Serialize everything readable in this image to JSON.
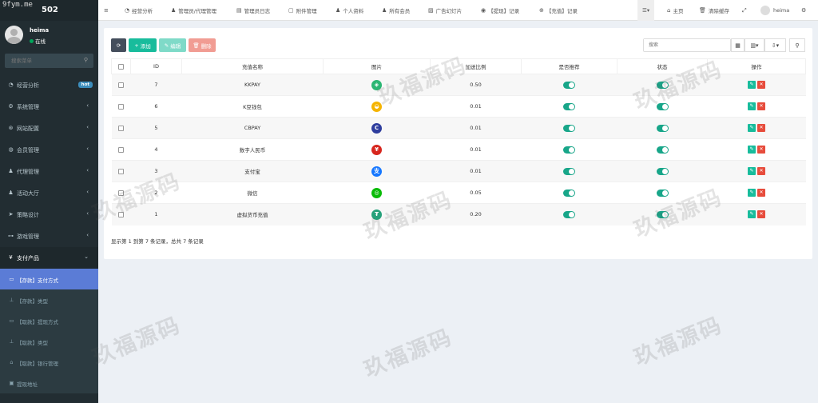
{
  "watermark_url": "9fym.me",
  "brand": "502",
  "user": {
    "name": "heima",
    "status": "在线"
  },
  "sidebar": {
    "search_placeholder": "搜索菜单",
    "items": [
      {
        "icon": "dashboard-icon",
        "label": "经营分析",
        "badge": "hot"
      },
      {
        "icon": "cogs-icon",
        "label": "系统管理"
      },
      {
        "icon": "gear-icon",
        "label": "网站配置"
      },
      {
        "icon": "user-icon",
        "label": "会员管理"
      },
      {
        "icon": "user-icon",
        "label": "代理管理"
      },
      {
        "icon": "user-icon",
        "label": "活动大厅"
      },
      {
        "icon": "paper-plane-icon",
        "label": "策略设计"
      },
      {
        "icon": "gamepad-icon",
        "label": "游戏管理"
      },
      {
        "icon": "yen-icon",
        "label": "支付产品"
      }
    ],
    "sub_items": [
      {
        "icon": "card-icon",
        "label": "【存款】支付方式"
      },
      {
        "icon": "sitemap-icon",
        "label": "【存款】类型"
      },
      {
        "icon": "card-icon",
        "label": "【取款】提现方式"
      },
      {
        "icon": "sitemap-icon",
        "label": "【取款】类型"
      },
      {
        "icon": "bank-icon",
        "label": "【取款】银行管理"
      },
      {
        "icon": "address-icon",
        "label": "提现地址"
      }
    ]
  },
  "topnav": {
    "items": [
      "经营分析",
      "管理员/代理管理",
      "管理员日志",
      "附件管理",
      "个人资料",
      "所有会员",
      "广告幻灯片",
      "【提现】记录",
      "【充值】记录"
    ],
    "home": "主页",
    "clear_cache": "清除缓存",
    "username": "heima"
  },
  "toolbar": {
    "add": "添加",
    "edit": "编辑",
    "delete": "删除",
    "search_placeholder": "搜索"
  },
  "table": {
    "headers": [
      "ID",
      "充值名称",
      "图片",
      "加送比例",
      "是否推荐",
      "状态",
      "操作"
    ],
    "rows": [
      {
        "id": "7",
        "name": "KKPAY",
        "ratio": "0.50",
        "icon": "kkpay-logo-icon",
        "color": "#2bb673"
      },
      {
        "id": "6",
        "name": "K豆钱包",
        "ratio": "0.01",
        "icon": "kdou-wallet-logo-icon",
        "color": "#f5b400"
      },
      {
        "id": "5",
        "name": "CBPAY",
        "ratio": "0.01",
        "icon": "cbpay-logo-icon",
        "color": "#2f3e9e"
      },
      {
        "id": "4",
        "name": "数字人民币",
        "ratio": "0.01",
        "icon": "ecny-logo-icon",
        "color": "#d7261e"
      },
      {
        "id": "3",
        "name": "支付宝",
        "ratio": "0.01",
        "icon": "alipay-logo-icon",
        "color": "#1677ff"
      },
      {
        "id": "2",
        "name": "微信",
        "ratio": "0.05",
        "icon": "wechat-logo-icon",
        "color": "#09bb07"
      },
      {
        "id": "1",
        "name": "虚拟货币充值",
        "ratio": "0.20",
        "icon": "usdt-logo-icon",
        "color": "#26a17b"
      }
    ],
    "summary": "显示第 1 到第 7 条记录，总共 7 条记录"
  },
  "watermark_text": "玖福源码"
}
